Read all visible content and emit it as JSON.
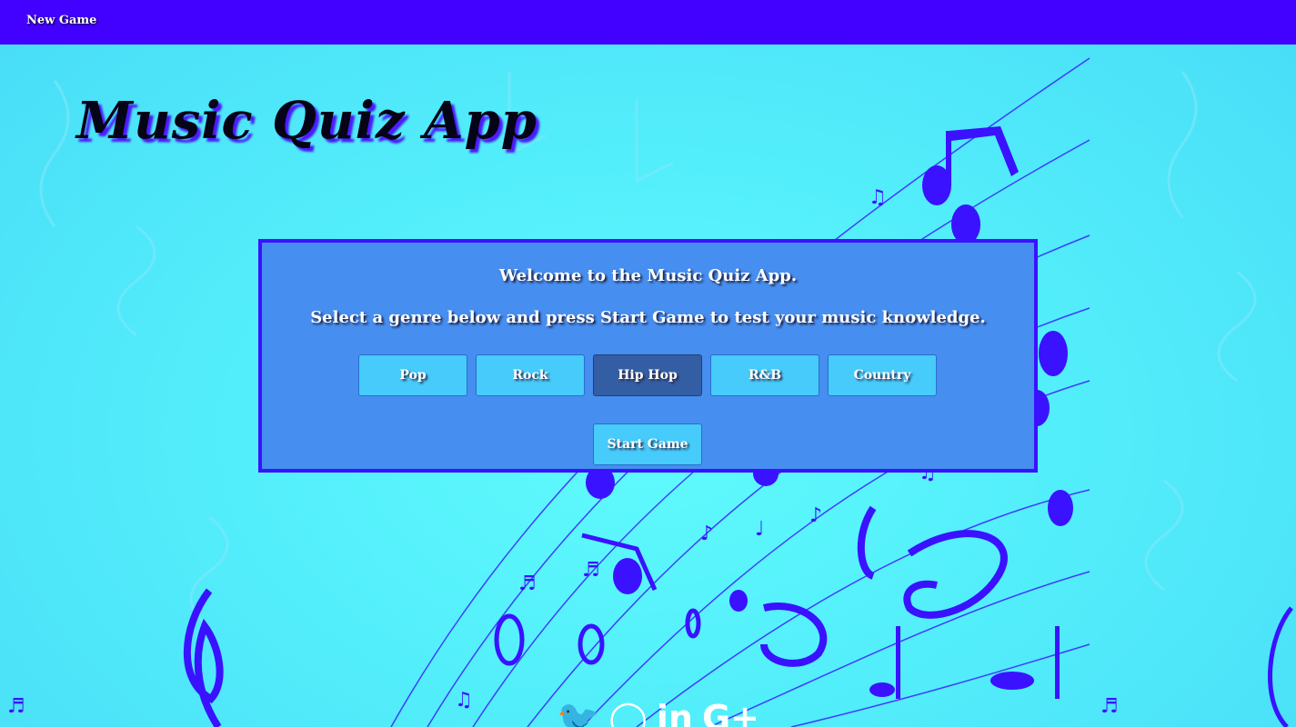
{
  "nav": {
    "new_game_label": "New Game"
  },
  "page": {
    "title": "Music Quiz App"
  },
  "panel": {
    "welcome": "Welcome to the Music Quiz App.",
    "instructions": "Select a genre below and press Start Game to test your music knowledge.",
    "genres": [
      {
        "label": "Pop",
        "selected": false
      },
      {
        "label": "Rock",
        "selected": false
      },
      {
        "label": "Hip Hop",
        "selected": true
      },
      {
        "label": "R&B",
        "selected": false
      },
      {
        "label": "Country",
        "selected": false
      }
    ],
    "start_label": "Start Game"
  },
  "social": {
    "icons": [
      "twitter-icon",
      "github-icon",
      "linkedin-icon",
      "google-plus-icon"
    ],
    "glyphs": [
      "🐦",
      "◯",
      "in",
      "G+"
    ]
  },
  "colors": {
    "nav_bar": "#4200ff",
    "background": "#53eefb",
    "panel": "#468ef0",
    "panel_border": "#3a12ff",
    "genre_button": "#46cbfb",
    "genre_selected": "#345ea3",
    "notes": "#3a12ff"
  }
}
